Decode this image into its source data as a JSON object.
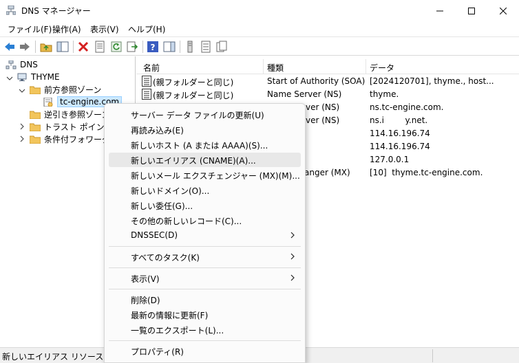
{
  "window": {
    "title": "DNS マネージャー"
  },
  "menubar": [
    "ファイル(F)",
    "操作(A)",
    "表示(V)",
    "ヘルプ(H)"
  ],
  "tree": {
    "root": "DNS",
    "server": "THYME",
    "forward_zones": "前方参照ゾーン",
    "zone": "tc-engine.com",
    "reverse_zones": "逆引き参照ゾーン",
    "trust_points": "トラスト ポイント",
    "conditional_forwarders": "条件付フォワーダー"
  },
  "list": {
    "columns": [
      "名前",
      "種類",
      "データ"
    ],
    "rows": [
      {
        "name": "(親フォルダーと同じ)",
        "type": "Start of Authority (SOA)",
        "data": "[2024120701], thyme., host..."
      },
      {
        "name": "(親フォルダーと同じ)",
        "type": "Name Server (NS)",
        "data": "thyme."
      },
      {
        "name": "",
        "type": "ver (NS)",
        "data": "ns.tc-engine.com."
      },
      {
        "name": "",
        "type": "ver (NS)",
        "data": "ns.i        y.net."
      },
      {
        "name": "",
        "type": "",
        "data": "114.16.196.74"
      },
      {
        "name": "",
        "type": "",
        "data": "114.16.196.74"
      },
      {
        "name": "",
        "type": "",
        "data": "127.0.0.1"
      },
      {
        "name": "",
        "type": "anger (MX)",
        "data": "[10]  thyme.tc-engine.com."
      }
    ]
  },
  "context_menu": {
    "items": [
      "サーバー データ ファイルの更新(U)",
      "再読み込み(E)",
      "新しいホスト (A または AAAA)(S)...",
      "新しいエイリアス (CNAME)(A)...",
      "新しいメール エクスチェンジャー (MX)(M)...",
      "新しいドメイン(O)...",
      "新しい委任(G)...",
      "その他の新しいレコード(C)...",
      "DNSSEC(D)",
      "すべてのタスク(K)",
      "表示(V)",
      "削除(D)",
      "最新の情報に更新(F)",
      "一覧のエクスポート(L)...",
      "プロパティ(R)"
    ]
  },
  "status": {
    "text": "新しいエイリアス リソース レコード"
  },
  "colors": {
    "accent_selected": "#cce8ff",
    "nav_arrow": "#2a7fd4",
    "delete": "#d42020"
  }
}
